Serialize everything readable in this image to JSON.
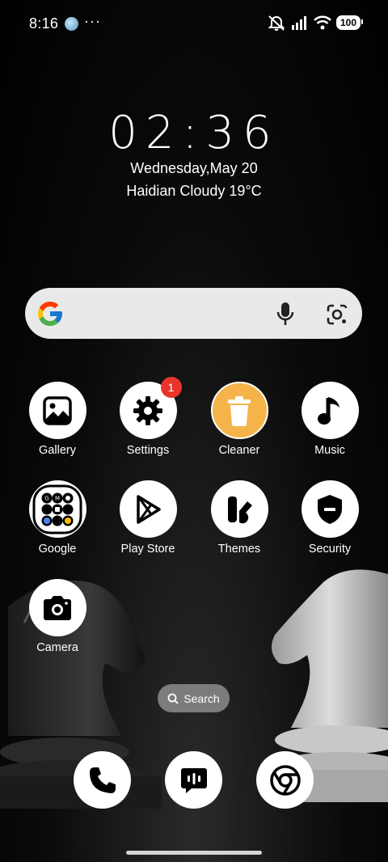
{
  "status_bar": {
    "time": "8:16",
    "dots": "···",
    "battery": "100"
  },
  "clock_widget": {
    "time": "02:36",
    "date": "Wednesday,May 20",
    "weather": "Haidian Cloudy 19°C"
  },
  "search_bar": {
    "logo": "google-g-icon",
    "mic": "mic-icon",
    "lens": "lens-icon"
  },
  "apps": [
    {
      "label": "Gallery"
    },
    {
      "label": "Settings",
      "badge": "1"
    },
    {
      "label": "Cleaner"
    },
    {
      "label": "Music"
    },
    {
      "label": "Google"
    },
    {
      "label": "Play Store"
    },
    {
      "label": "Themes"
    },
    {
      "label": "Security"
    },
    {
      "label": "Camera"
    }
  ],
  "search_pill": {
    "label": "Search"
  },
  "dock": [
    "phone-icon",
    "messages-icon",
    "chrome-icon"
  ],
  "colors": {
    "cleaner_bg": "#f5b44a",
    "badge": "#e8342b",
    "search_bar_bg": "#e9e9ea"
  }
}
